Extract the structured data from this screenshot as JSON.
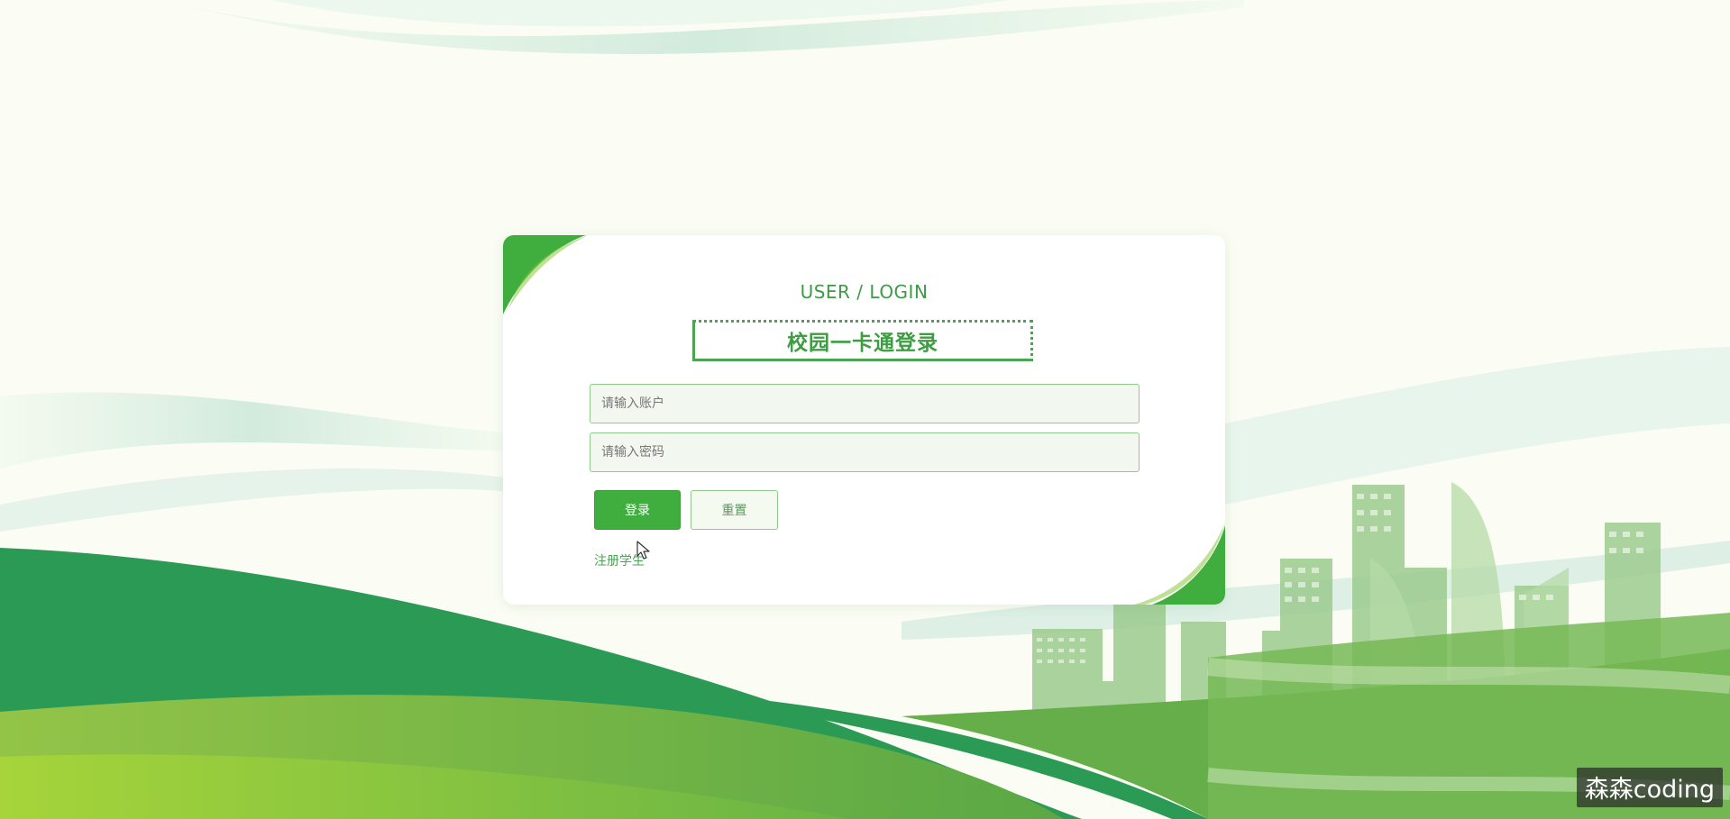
{
  "login": {
    "subtitle": "USER / LOGIN",
    "title": "校园一卡通登录",
    "account_placeholder": "请输入账户",
    "password_placeholder": "请输入密码",
    "login_label": "登录",
    "reset_label": "重置",
    "register_label": "注册学生"
  },
  "watermark": "森森coding",
  "colors": {
    "accent": "#3fae3e",
    "dark_green": "#2a9a55",
    "light_green": "#8dc63f",
    "background": "#fbfdf4"
  },
  "icons": {
    "cursor": "mouse-pointer-icon"
  }
}
